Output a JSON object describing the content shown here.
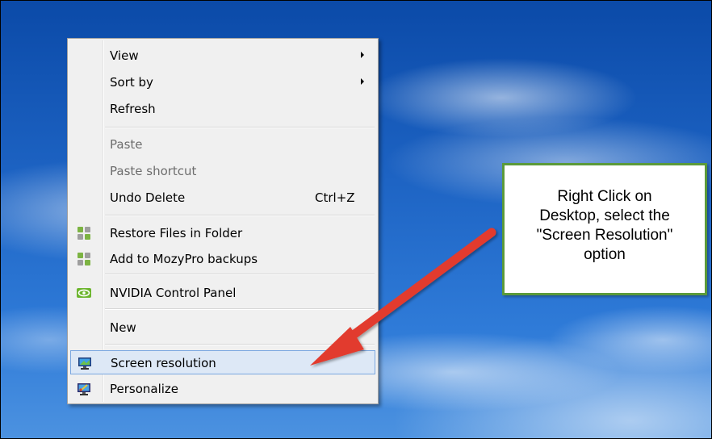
{
  "menu": {
    "items": [
      {
        "label": "View"
      },
      {
        "label": "Sort by"
      },
      {
        "label": "Refresh"
      },
      {
        "label": "Paste"
      },
      {
        "label": "Paste shortcut"
      },
      {
        "label": "Undo Delete",
        "shortcut": "Ctrl+Z"
      },
      {
        "label": "Restore Files in Folder"
      },
      {
        "label": "Add to MozyPro backups"
      },
      {
        "label": "NVIDIA Control Panel"
      },
      {
        "label": "New"
      },
      {
        "label": "Screen resolution"
      },
      {
        "label": "Personalize"
      }
    ]
  },
  "callout": {
    "lines": [
      "Right Click on",
      "Desktop, select the",
      "\"Screen Resolution\"",
      "option"
    ]
  },
  "colors": {
    "callout_border": "#5b9a3a",
    "arrow": "#e23b2e",
    "highlight_bg": "#dde8f6",
    "highlight_border": "#7aa7e0"
  }
}
